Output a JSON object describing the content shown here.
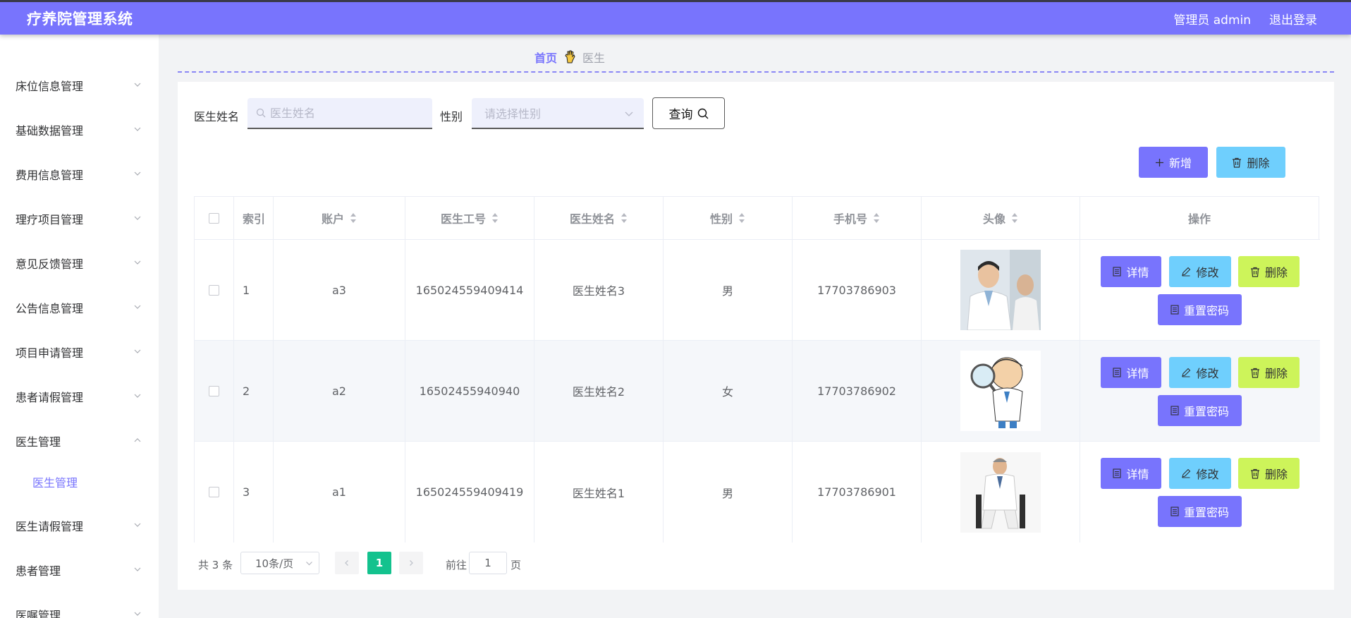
{
  "header": {
    "title": "疗养院管理系统",
    "user": "管理员 admin",
    "logout": "退出登录"
  },
  "sidebar": {
    "items": [
      {
        "label": "床位信息管理"
      },
      {
        "label": "基础数据管理"
      },
      {
        "label": "费用信息管理"
      },
      {
        "label": "理疗项目管理"
      },
      {
        "label": "意见反馈管理"
      },
      {
        "label": "公告信息管理"
      },
      {
        "label": "项目申请管理"
      },
      {
        "label": "患者请假管理"
      },
      {
        "label": "医生管理"
      },
      {
        "label": "医生请假管理"
      },
      {
        "label": "患者管理"
      },
      {
        "label": "医嘱管理"
      }
    ],
    "sub_item": "医生管理"
  },
  "breadcrumb": {
    "home": "首页",
    "current": "医生"
  },
  "search": {
    "name_label": "医生姓名",
    "name_placeholder": "医生姓名",
    "gender_label": "性别",
    "gender_placeholder": "请选择性别",
    "query_label": "查询"
  },
  "actions": {
    "add_label": "新增",
    "delete_label": "删除"
  },
  "table": {
    "headers": [
      "索引",
      "账户",
      "医生工号",
      "医生姓名",
      "性别",
      "手机号",
      "头像",
      "操作"
    ],
    "rows": [
      {
        "index": "1",
        "account": "a3",
        "id": "165024559409414",
        "name": "医生姓名3",
        "gender": "男",
        "phone": "17703786903"
      },
      {
        "index": "2",
        "account": "a2",
        "id": "16502455940940",
        "name": "医生姓名2",
        "gender": "女",
        "phone": "17703786902"
      },
      {
        "index": "3",
        "account": "a1",
        "id": "165024559409419",
        "name": "医生姓名1",
        "gender": "男",
        "phone": "17703786901"
      }
    ],
    "op_labels": {
      "detail": "详情",
      "edit": "修改",
      "delete": "删除",
      "reset": "重置密码"
    }
  },
  "pagination": {
    "total_text": "共 3 条",
    "page_size": "10条/页",
    "current_page": "1",
    "goto_label": "前往",
    "goto_value": "1",
    "page_suffix": "页"
  },
  "colors": {
    "primary": "#7874fd",
    "cyan": "#6fcffd",
    "lime": "#cdf45a",
    "page_active": "#13c28e"
  }
}
